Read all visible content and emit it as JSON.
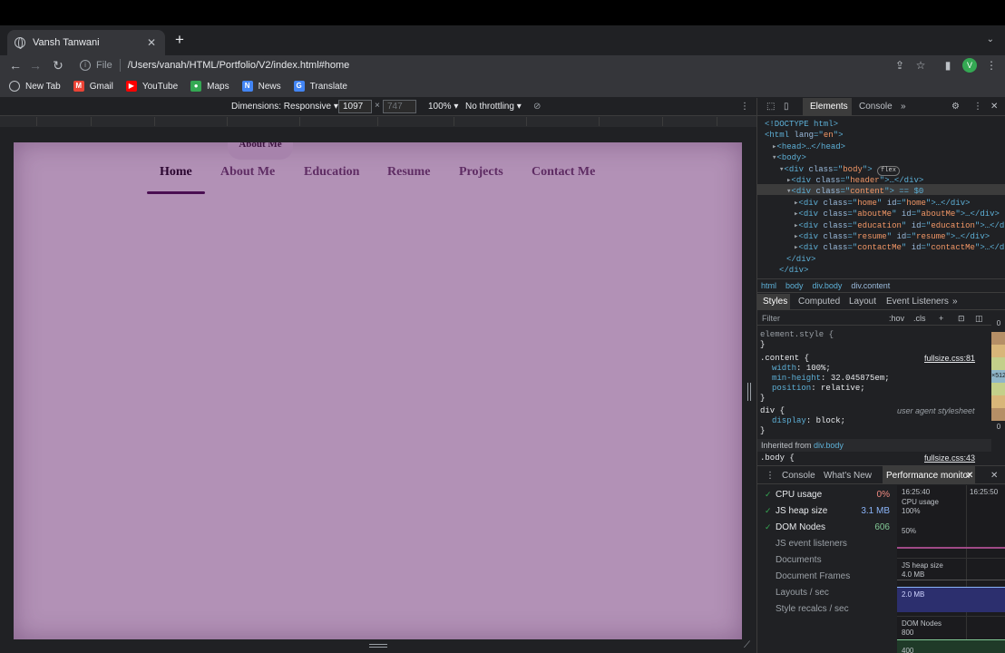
{
  "browser": {
    "tab_title": "Vansh Tanwani",
    "tab_close": "✕",
    "new_tab": "+",
    "url_scheme_label": "File",
    "url": "/Users/vanah/HTML/Portfolio/V2/index.html#home",
    "profile_initial": "V",
    "bookmarks": [
      {
        "label": "New Tab",
        "icon": "globe-icon",
        "color": "#5f6368",
        "glyph": ""
      },
      {
        "label": "Gmail",
        "icon": "gmail-icon",
        "color": "#ea4335",
        "glyph": "M"
      },
      {
        "label": "YouTube",
        "icon": "youtube-icon",
        "color": "#ff0000",
        "glyph": "▶"
      },
      {
        "label": "Maps",
        "icon": "maps-icon",
        "color": "#34a853",
        "glyph": "●"
      },
      {
        "label": "News",
        "icon": "news-icon",
        "color": "#4285f4",
        "glyph": "N"
      },
      {
        "label": "Translate",
        "icon": "translate-icon",
        "color": "#4285f4",
        "glyph": "G"
      }
    ]
  },
  "device_toolbar": {
    "dimensions_label": "Dimensions: Responsive ▾",
    "width": "1097",
    "times": "×",
    "height": "747",
    "zoom": "100% ▾",
    "throttling": "No throttling ▾"
  },
  "site": {
    "floating_label": "About Me",
    "nav": [
      "Home",
      "About Me",
      "Education",
      "Resume",
      "Projects",
      "Contact Me"
    ],
    "active_index": 0,
    "background_color": "#b291b6",
    "accent_color": "#4a0e52"
  },
  "devtools": {
    "tabs": [
      "Elements",
      "Console"
    ],
    "more": "»",
    "dom_lines": [
      {
        "indent": 0,
        "html": "<!DOCTYPE html>"
      },
      {
        "indent": 0,
        "tag": "html",
        "attrs": [
          [
            "lang",
            "en"
          ]
        ],
        "tail": ">"
      },
      {
        "indent": 1,
        "arrow": "▸",
        "tag": "head",
        "tail": ">…</head>"
      },
      {
        "indent": 1,
        "arrow": "▾",
        "tag": "body",
        "tail": ">"
      },
      {
        "indent": 2,
        "arrow": "▾",
        "tag": "div",
        "attrs": [
          [
            "class",
            "body"
          ]
        ],
        "tail": ">",
        "badge": "flex"
      },
      {
        "indent": 3,
        "arrow": "▸",
        "tag": "div",
        "attrs": [
          [
            "class",
            "header"
          ]
        ],
        "tail": ">…</div>"
      },
      {
        "indent": 3,
        "arrow": "▾",
        "tag": "div",
        "attrs": [
          [
            "class",
            "content"
          ]
        ],
        "tail": "> == $0",
        "selected": true
      },
      {
        "indent": 4,
        "arrow": "▸",
        "tag": "div",
        "attrs": [
          [
            "class",
            "home"
          ],
          [
            "id",
            "home"
          ]
        ],
        "tail": ">…</div>"
      },
      {
        "indent": 4,
        "arrow": "▸",
        "tag": "div",
        "attrs": [
          [
            "class",
            "aboutMe"
          ],
          [
            "id",
            "aboutMe"
          ]
        ],
        "tail": ">…</div>"
      },
      {
        "indent": 4,
        "arrow": "▸",
        "tag": "div",
        "attrs": [
          [
            "class",
            "education"
          ],
          [
            "id",
            "education"
          ]
        ],
        "tail": ">…</div>"
      },
      {
        "indent": 4,
        "arrow": "▸",
        "tag": "div",
        "attrs": [
          [
            "class",
            "resume"
          ],
          [
            "id",
            "resume"
          ]
        ],
        "tail": ">…</div>"
      },
      {
        "indent": 4,
        "arrow": "▸",
        "tag": "div",
        "attrs": [
          [
            "class",
            "contactMe"
          ],
          [
            "id",
            "contactMe"
          ]
        ],
        "tail": ">…</div>"
      },
      {
        "indent": 3,
        "html": "</div>"
      },
      {
        "indent": 2,
        "html": "</div>"
      }
    ],
    "breadcrumbs": [
      "html",
      "body",
      "div.body",
      "div.content"
    ],
    "style_tabs": [
      "Styles",
      "Computed",
      "Layout",
      "Event Listeners",
      "»"
    ],
    "filter_placeholder": "Filter",
    "hov": ":hov",
    "cls": ".cls",
    "rules": {
      "element_style": "element.style {",
      "close": "}",
      "content_selector": ".content {",
      "content_source": "fullsize.css:81",
      "content_props": [
        [
          "width",
          "100%;"
        ],
        [
          "min-height",
          "32.045875em;"
        ],
        [
          "position",
          "relative;"
        ]
      ],
      "div_selector": "div {",
      "div_source": "user agent stylesheet",
      "div_props": [
        [
          "display",
          "block;"
        ]
      ],
      "inherited_label": "Inherited from",
      "inherited_from": "div.body",
      "body_selector": ".body {",
      "body_source": "fullsize.css:43"
    },
    "box_model": {
      "top": "0",
      "value": "×512",
      "bottom": "0"
    },
    "drawer": {
      "tabs": [
        "Console",
        "What's New",
        "Performance monitor"
      ],
      "metrics": [
        {
          "name": "CPU usage",
          "value": "0%",
          "checked": true,
          "color": "#f28b82"
        },
        {
          "name": "JS heap size",
          "value": "3.1 MB",
          "checked": true,
          "color": "#8ab4f8"
        },
        {
          "name": "DOM Nodes",
          "value": "606",
          "checked": true,
          "color": "#81c995"
        },
        {
          "name": "JS event listeners",
          "value": "",
          "checked": false,
          "color": ""
        },
        {
          "name": "Documents",
          "value": "",
          "checked": false,
          "color": ""
        },
        {
          "name": "Document Frames",
          "value": "",
          "checked": false,
          "color": ""
        },
        {
          "name": "Layouts / sec",
          "value": "",
          "checked": false,
          "color": ""
        },
        {
          "name": "Style recalcs / sec",
          "value": "",
          "checked": false,
          "color": ""
        }
      ],
      "graph": {
        "times": [
          "16:25:40",
          "16:25:50"
        ],
        "cpu_label": "CPU usage",
        "cpu_ticks": [
          "100%",
          "50%"
        ],
        "heap_label": "JS heap size",
        "heap_ticks": [
          "4.0 MB",
          "2.0 MB"
        ],
        "dom_label": "DOM Nodes",
        "dom_ticks": [
          "800",
          "400"
        ]
      }
    }
  }
}
